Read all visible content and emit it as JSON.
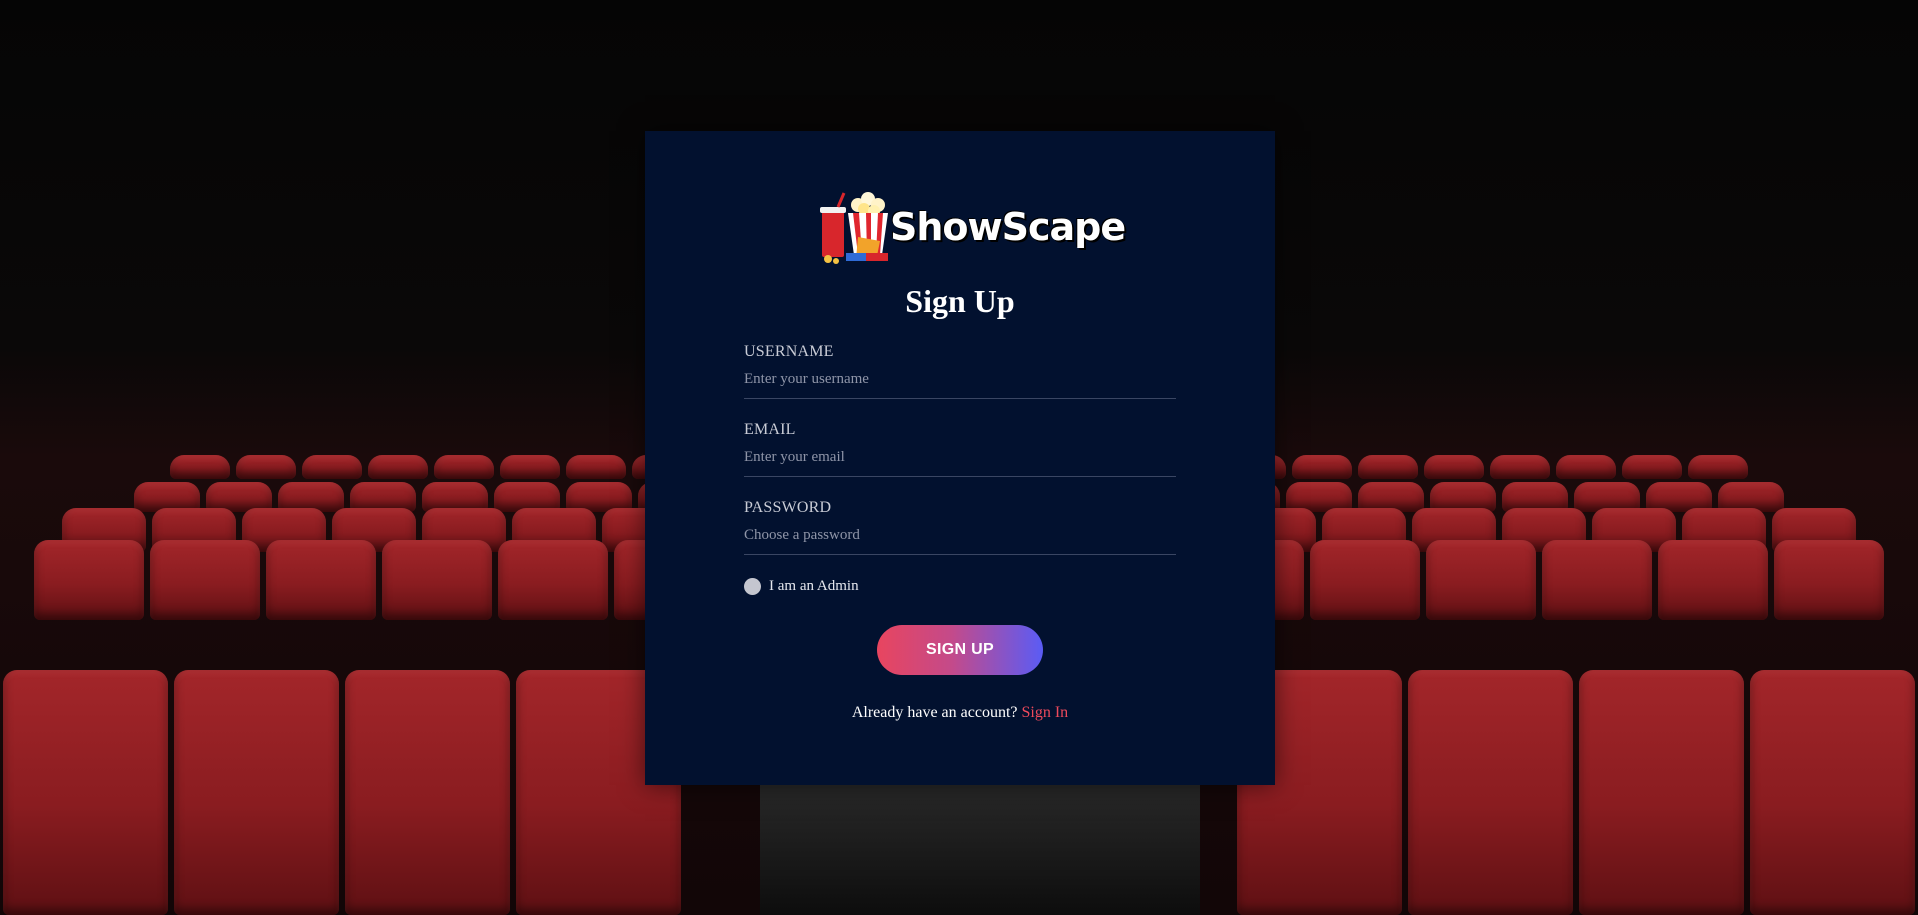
{
  "brand": {
    "name": "ShowScape"
  },
  "form": {
    "title": "Sign Up",
    "fields": [
      {
        "label": "USERNAME",
        "placeholder": "Enter your username",
        "value": ""
      },
      {
        "label": "EMAIL",
        "placeholder": "Enter your email",
        "value": ""
      },
      {
        "label": "PASSWORD",
        "placeholder": "Choose a password",
        "value": ""
      }
    ],
    "admin_option": {
      "label": "I am an Admin",
      "checked": false
    },
    "submit_label": "SIGN UP",
    "footer_prompt": "Already have an account?",
    "footer_link": "Sign In"
  },
  "colors": {
    "card_background": "#02112f",
    "link_accent": "#ee4a5c",
    "button_gradient_start": "#e8455f",
    "button_gradient_end": "#5a5cf5",
    "seat_red": "#8a1c20"
  }
}
